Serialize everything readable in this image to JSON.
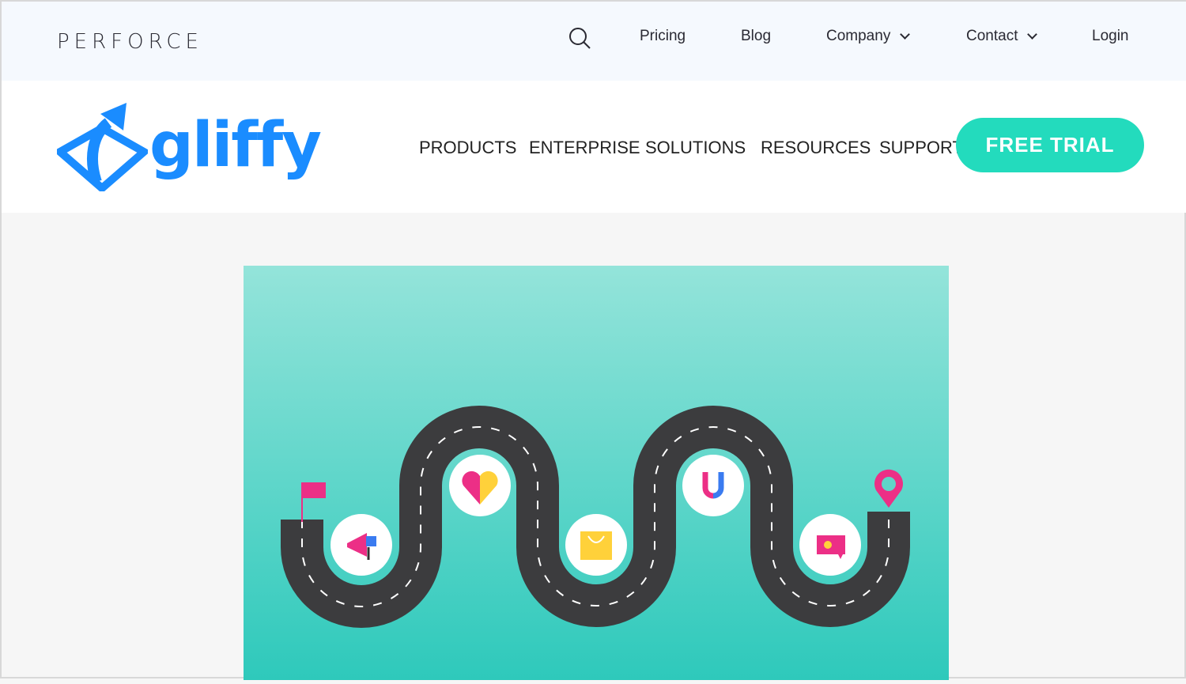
{
  "topbar": {
    "brand": "PERFORCE",
    "links": [
      {
        "label": "Pricing"
      },
      {
        "label": "Blog"
      },
      {
        "label": "Company",
        "dropdown": true
      },
      {
        "label": "Contact",
        "dropdown": true
      },
      {
        "label": "Login"
      }
    ],
    "search_icon": "search-icon"
  },
  "mainnav": {
    "logo_text": "gliffy",
    "items": [
      "PRODUCTS",
      "ENTERPRISE",
      "SOLUTIONS",
      "RESOURCES",
      "SUPPORT"
    ],
    "cta": "FREE TRIAL"
  },
  "colors": {
    "brand_blue": "#1a8cff",
    "cta": "#23dbbd",
    "road": "#3c3c3e",
    "pink": "#ec2f86",
    "yellow": "#ffd13a"
  },
  "hero": {
    "icons": [
      "flag-icon",
      "megaphone-icon",
      "heart-icon",
      "shopping-bag-icon",
      "magnet-icon",
      "chat-heart-icon",
      "location-pin-icon"
    ]
  }
}
